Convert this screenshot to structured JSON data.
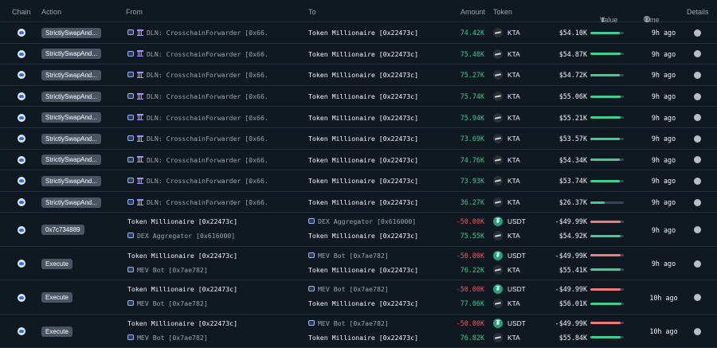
{
  "columns": {
    "chain": "Chain",
    "action": "Action",
    "from": "From",
    "to": "To",
    "amount": "Amount",
    "token": "Token",
    "value": "Value",
    "time": "Time",
    "details": "Details",
    "sort_glyph": "⬍"
  },
  "colors": {
    "positive": "#3ecf8e",
    "negative": "#f25a5a",
    "usdt": "#26a17b",
    "action_badge": "#4a5563"
  },
  "rows": [
    {
      "action": "StrictlySwapAnd...",
      "time": "9h ago",
      "legs": [
        {
          "from": "DLN: CrosschainForwarder [0x66...",
          "from_icons": [
            "robot-icon",
            "bank-icon"
          ],
          "from_dim": true,
          "to": "Token Millionaire [0x22473c]",
          "to_icons": [],
          "to_dim": false,
          "amount": "74.42K",
          "sign": "pos",
          "token": "KTA",
          "token_icon": "kta",
          "value": "$54.10K",
          "bar": 0.88
        }
      ]
    },
    {
      "action": "StrictlySwapAnd...",
      "time": "9h ago",
      "legs": [
        {
          "from": "DLN: CrosschainForwarder [0x66...",
          "from_icons": [
            "robot-icon",
            "bank-icon"
          ],
          "from_dim": true,
          "to": "Token Millionaire [0x22473c]",
          "to_icons": [],
          "to_dim": false,
          "amount": "75.48K",
          "sign": "pos",
          "token": "KTA",
          "token_icon": "kta",
          "value": "$54.87K",
          "bar": 0.9
        }
      ]
    },
    {
      "action": "StrictlySwapAnd...",
      "time": "9h ago",
      "legs": [
        {
          "from": "DLN: CrosschainForwarder [0x66...",
          "from_icons": [
            "robot-icon",
            "bank-icon"
          ],
          "from_dim": true,
          "to": "Token Millionaire [0x22473c]",
          "to_icons": [],
          "to_dim": false,
          "amount": "75.27K",
          "sign": "pos",
          "token": "KTA",
          "token_icon": "kta",
          "value": "$54.72K",
          "bar": 0.89
        }
      ]
    },
    {
      "action": "StrictlySwapAnd...",
      "time": "9h ago",
      "legs": [
        {
          "from": "DLN: CrosschainForwarder [0x66...",
          "from_icons": [
            "robot-icon",
            "bank-icon"
          ],
          "from_dim": true,
          "to": "Token Millionaire [0x22473c]",
          "to_icons": [],
          "to_dim": false,
          "amount": "75.74K",
          "sign": "pos",
          "token": "KTA",
          "token_icon": "kta",
          "value": "$55.06K",
          "bar": 0.9
        }
      ]
    },
    {
      "action": "StrictlySwapAnd...",
      "time": "9h ago",
      "legs": [
        {
          "from": "DLN: CrosschainForwarder [0x66...",
          "from_icons": [
            "robot-icon",
            "bank-icon"
          ],
          "from_dim": true,
          "to": "Token Millionaire [0x22473c]",
          "to_icons": [],
          "to_dim": false,
          "amount": "75.94K",
          "sign": "pos",
          "token": "KTA",
          "token_icon": "kta",
          "value": "$55.21K",
          "bar": 0.91
        }
      ]
    },
    {
      "action": "StrictlySwapAnd...",
      "time": "9h ago",
      "legs": [
        {
          "from": "DLN: CrosschainForwarder [0x66...",
          "from_icons": [
            "robot-icon",
            "bank-icon"
          ],
          "from_dim": true,
          "to": "Token Millionaire [0x22473c]",
          "to_icons": [],
          "to_dim": false,
          "amount": "73.69K",
          "sign": "pos",
          "token": "KTA",
          "token_icon": "kta",
          "value": "$53.57K",
          "bar": 0.88
        }
      ]
    },
    {
      "action": "StrictlySwapAnd...",
      "time": "9h ago",
      "legs": [
        {
          "from": "DLN: CrosschainForwarder [0x66...",
          "from_icons": [
            "robot-icon",
            "bank-icon"
          ],
          "from_dim": true,
          "to": "Token Millionaire [0x22473c]",
          "to_icons": [],
          "to_dim": false,
          "amount": "74.76K",
          "sign": "pos",
          "token": "KTA",
          "token_icon": "kta",
          "value": "$54.34K",
          "bar": 0.89
        }
      ]
    },
    {
      "action": "StrictlySwapAnd...",
      "time": "9h ago",
      "legs": [
        {
          "from": "DLN: CrosschainForwarder [0x66...",
          "from_icons": [
            "robot-icon",
            "bank-icon"
          ],
          "from_dim": true,
          "to": "Token Millionaire [0x22473c]",
          "to_icons": [],
          "to_dim": false,
          "amount": "73.93K",
          "sign": "pos",
          "token": "KTA",
          "token_icon": "kta",
          "value": "$53.74K",
          "bar": 0.88
        }
      ]
    },
    {
      "action": "StrictlySwapAnd...",
      "time": "9h ago",
      "legs": [
        {
          "from": "DLN: CrosschainForwarder [0x66...",
          "from_icons": [
            "robot-icon",
            "bank-icon"
          ],
          "from_dim": true,
          "to": "Token Millionaire [0x22473c]",
          "to_icons": [],
          "to_dim": false,
          "amount": "36.27K",
          "sign": "pos",
          "token": "KTA",
          "token_icon": "kta",
          "value": "$26.37K",
          "bar": 0.42
        }
      ]
    },
    {
      "action": "0x7c734889",
      "time": "9h ago",
      "legs": [
        {
          "from": "Token Millionaire [0x22473c]",
          "from_icons": [],
          "from_dim": false,
          "to": "DEX Aggregator [0x616000]",
          "to_icons": [
            "robot-icon"
          ],
          "to_dim": true,
          "amount": "-50.00K",
          "sign": "neg",
          "token": "USDT",
          "token_icon": "usdt",
          "value": "-$49.99K",
          "bar": 0.9
        },
        {
          "from": "DEX Aggregator [0x616000]",
          "from_icons": [
            "robot-icon"
          ],
          "from_dim": true,
          "to": "Token Millionaire [0x22473c]",
          "to_icons": [],
          "to_dim": false,
          "amount": "75.55K",
          "sign": "pos",
          "token": "KTA",
          "token_icon": "kta",
          "value": "$54.92K",
          "bar": 0.9
        }
      ]
    },
    {
      "action": "Execute",
      "time": "9h ago",
      "legs": [
        {
          "from": "Token Millionaire [0x22473c]",
          "from_icons": [],
          "from_dim": false,
          "to": "MEV Bot [0x7ae782]",
          "to_icons": [
            "robot-icon"
          ],
          "to_dim": true,
          "amount": "-50.00K",
          "sign": "neg",
          "token": "USDT",
          "token_icon": "usdt",
          "value": "-$49.99K",
          "bar": 0.9
        },
        {
          "from": "MEV Bot [0x7ae782]",
          "from_icons": [
            "robot-icon"
          ],
          "from_dim": true,
          "to": "Token Millionaire [0x22473c]",
          "to_icons": [],
          "to_dim": false,
          "amount": "76.22K",
          "sign": "pos",
          "token": "KTA",
          "token_icon": "kta",
          "value": "$55.41K",
          "bar": 0.91
        }
      ]
    },
    {
      "action": "Execute",
      "time": "10h ago",
      "legs": [
        {
          "from": "Token Millionaire [0x22473c]",
          "from_icons": [],
          "from_dim": false,
          "to": "MEV Bot [0x7ae782]",
          "to_icons": [
            "robot-icon"
          ],
          "to_dim": true,
          "amount": "-50.00K",
          "sign": "neg",
          "token": "USDT",
          "token_icon": "usdt",
          "value": "-$49.99K",
          "bar": 0.9
        },
        {
          "from": "MEV Bot [0x7ae782]",
          "from_icons": [
            "robot-icon"
          ],
          "from_dim": true,
          "to": "Token Millionaire [0x22473c]",
          "to_icons": [],
          "to_dim": false,
          "amount": "77.06K",
          "sign": "pos",
          "token": "KTA",
          "token_icon": "kta",
          "value": "$56.01K",
          "bar": 0.92
        }
      ]
    },
    {
      "action": "Execute",
      "time": "10h ago",
      "legs": [
        {
          "from": "Token Millionaire [0x22473c]",
          "from_icons": [],
          "from_dim": false,
          "to": "MEV Bot [0x7ae782]",
          "to_icons": [
            "robot-icon"
          ],
          "to_dim": true,
          "amount": "-50.00K",
          "sign": "neg",
          "token": "USDT",
          "token_icon": "usdt",
          "value": "-$49.99K",
          "bar": 0.9
        },
        {
          "from": "MEV Bot [0x7ae782]",
          "from_icons": [
            "robot-icon"
          ],
          "from_dim": true,
          "to": "Token Millionaire [0x22473c]",
          "to_icons": [],
          "to_dim": false,
          "amount": "76.82K",
          "sign": "pos",
          "token": "KTA",
          "token_icon": "kta",
          "value": "$55.84K",
          "bar": 0.91
        }
      ]
    }
  ]
}
